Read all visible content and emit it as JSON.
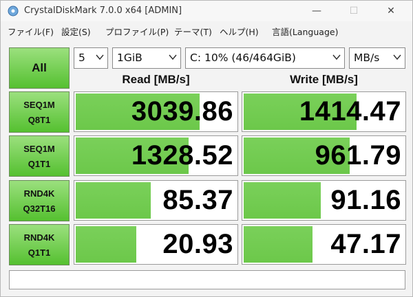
{
  "window": {
    "title": "CrystalDiskMark 7.0.0 x64 [ADMIN]",
    "controls": {
      "minimize": "—",
      "maximize": "☐",
      "close": "✕"
    }
  },
  "menu": [
    "ファイル(F)",
    "設定(S)",
    "プロファイル(P)",
    "テーマ(T)",
    "ヘルプ(H)",
    "言語(Language)"
  ],
  "toolbar": {
    "all_label": "All",
    "count": "5",
    "size": "1GiB",
    "drive": "C: 10% (46/464GiB)",
    "unit": "MB/s"
  },
  "columns": {
    "read": "Read [MB/s]",
    "write": "Write [MB/s]"
  },
  "rows": [
    {
      "name1": "SEQ1M",
      "name2": "Q8T1",
      "read": "3039.86",
      "write": "1414.47",
      "read_fill": 0.77,
      "write_fill": 0.7
    },
    {
      "name1": "SEQ1M",
      "name2": "Q1T1",
      "read": "1328.52",
      "write": "961.79",
      "read_fill": 0.7,
      "write_fill": 0.66
    },
    {
      "name1": "RND4K",
      "name2": "Q32T16",
      "read": "85.37",
      "write": "91.16",
      "read_fill": 0.47,
      "write_fill": 0.48
    },
    {
      "name1": "RND4K",
      "name2": "Q1T1",
      "read": "20.93",
      "write": "47.17",
      "read_fill": 0.38,
      "write_fill": 0.43
    }
  ],
  "status": "",
  "colors": {
    "accent_green": "#6cc84a",
    "label_green": "#55c030"
  }
}
